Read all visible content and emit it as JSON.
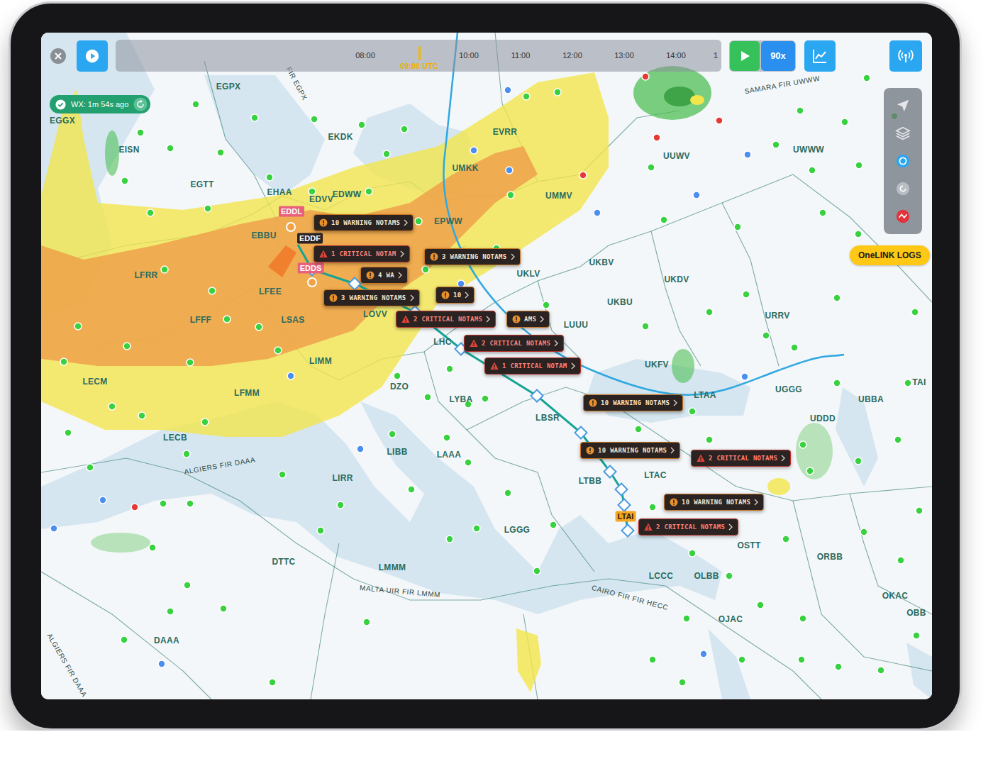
{
  "top_bar": {
    "timeline": {
      "ticks": [
        "08:00",
        "10:00",
        "11:00",
        "12:00",
        "13:00",
        "14:00",
        "1"
      ],
      "current": "09:00 UTC"
    },
    "speed": "90x"
  },
  "weather_status": {
    "text": "WX: 1m 54s ago"
  },
  "map_tools": [
    {
      "kind": "navigate",
      "selected": false
    },
    {
      "kind": "layers",
      "selected": false
    },
    {
      "kind": "radar",
      "selected": true
    },
    {
      "kind": "refresh",
      "selected": false
    },
    {
      "kind": "alerts",
      "selected": false
    }
  ],
  "logs_button": {
    "label": "OneLINK LOGS"
  },
  "airports": [
    {
      "code": "EDDL",
      "color": "#e8607c"
    },
    {
      "code": "EDDF",
      "color": "#2a2222"
    },
    {
      "code": "EDDS",
      "color": "#e8607c"
    },
    {
      "code": "LTAI",
      "color": "#f5a623"
    }
  ],
  "notams": [
    {
      "text": "10 WARNING NOTAMS",
      "kind": "warning"
    },
    {
      "text": "1 CRITICAL NOTAM",
      "kind": "critical"
    },
    {
      "text": "3 WARNING NOTAMS",
      "kind": "warning"
    },
    {
      "text": "4 WA",
      "kind": "warning"
    },
    {
      "text": "3 WARNING NOTAMS",
      "kind": "warning"
    },
    {
      "text": "10",
      "kind": "warning"
    },
    {
      "text": "2 CRITICAL NOTAMS",
      "kind": "critical"
    },
    {
      "text": "AMS",
      "kind": "warning"
    },
    {
      "text": "2 CRITICAL NOTAMS",
      "kind": "critical"
    },
    {
      "text": "1 CRITICAL NOTAM",
      "kind": "critical"
    },
    {
      "text": "10 WARNING NOTAMS",
      "kind": "warning"
    },
    {
      "text": "10 WARNING NOTAMS",
      "kind": "warning"
    },
    {
      "text": "2 CRITICAL NOTAMS",
      "kind": "critical"
    },
    {
      "text": "10 WARNING NOTAMS",
      "kind": "warning"
    },
    {
      "text": "2 CRITICAL NOTAMS",
      "kind": "critical"
    }
  ],
  "region_labels": [
    {
      "text": "EGGX"
    },
    {
      "text": "EGPX"
    },
    {
      "text": "EISN"
    },
    {
      "text": "EGTT"
    },
    {
      "text": "EHAA"
    },
    {
      "text": "EDVV"
    },
    {
      "text": "EDWW"
    },
    {
      "text": "EKDK"
    },
    {
      "text": "EVRR"
    },
    {
      "text": "UMKK"
    },
    {
      "text": "UMMV"
    },
    {
      "text": "EPWW"
    },
    {
      "text": "EBBU"
    },
    {
      "text": "LFRR"
    },
    {
      "text": "LFFF"
    },
    {
      "text": "LFEE"
    },
    {
      "text": "LSAS"
    },
    {
      "text": "LOVV"
    },
    {
      "text": "LHC"
    },
    {
      "text": "LIMM"
    },
    {
      "text": "LECM"
    },
    {
      "text": "LFMM"
    },
    {
      "text": "DZO"
    },
    {
      "text": "LYBA"
    },
    {
      "text": "LBSR"
    },
    {
      "text": "LECB"
    },
    {
      "text": "LIBB"
    },
    {
      "text": "LAAA"
    },
    {
      "text": "LIRR"
    },
    {
      "text": "LGGG"
    },
    {
      "text": "LTBB"
    },
    {
      "text": "LTAC"
    },
    {
      "text": "LTAA"
    },
    {
      "text": "UKLV"
    },
    {
      "text": "UKBV"
    },
    {
      "text": "UKDV"
    },
    {
      "text": "UKBU"
    },
    {
      "text": "LUUU"
    },
    {
      "text": "URRV"
    },
    {
      "text": "UKFV"
    },
    {
      "text": "UGGG"
    },
    {
      "text": "UBBA"
    },
    {
      "text": "UDDD"
    },
    {
      "text": "ORBB"
    },
    {
      "text": "OSTT"
    },
    {
      "text": "OLBB"
    },
    {
      "text": "LCCC"
    },
    {
      "text": "OJAC"
    },
    {
      "text": "OKAC"
    },
    {
      "text": "OBB"
    },
    {
      "text": "TAI"
    },
    {
      "text": "DTTC"
    },
    {
      "text": "LMMM"
    },
    {
      "text": "DAAA"
    },
    {
      "text": "UUWV"
    },
    {
      "text": "UWWW"
    }
  ],
  "fir_labels": [
    {
      "text": "FIR EGPX"
    },
    {
      "text": "SAMARA FIR UWWW"
    },
    {
      "text": "ALGIERS FIR DAAA"
    },
    {
      "text": "MALTA UIR FIR LMMM"
    },
    {
      "text": "CAIRO FIR FIR HECC"
    },
    {
      "text": "ALGIERS FIR DAAA"
    }
  ],
  "stations": [
    {
      "color": "#38d13f"
    },
    {
      "color": "#38d13f"
    },
    {
      "color": "#38d13f"
    },
    {
      "color": "#38d13f"
    },
    {
      "color": "#38d13f"
    },
    {
      "color": "#38d13f"
    },
    {
      "color": "#38d13f"
    },
    {
      "color": "#38d13f"
    },
    {
      "color": "#38d13f"
    },
    {
      "color": "#4b8ef0"
    },
    {
      "color": "#4b8ef0"
    },
    {
      "color": "#38d13f"
    },
    {
      "color": "#38d13f"
    },
    {
      "color": "#38d13f"
    },
    {
      "color": "#4b8ef0"
    },
    {
      "color": "#38d13f"
    },
    {
      "color": "#38d13f"
    },
    {
      "color": "#38d13f"
    },
    {
      "color": "#38d13f"
    },
    {
      "color": "#38d13f"
    },
    {
      "color": "#38d13f"
    },
    {
      "color": "#38d13f"
    },
    {
      "color": "#e53935"
    },
    {
      "color": "#e53935"
    },
    {
      "color": "#e53935"
    },
    {
      "color": "#e53935"
    },
    {
      "color": "#4b8ef0"
    },
    {
      "color": "#38d13f"
    },
    {
      "color": "#4b8ef0"
    },
    {
      "color": "#38d13f"
    },
    {
      "color": "#4b8ef0"
    },
    {
      "color": "#38d13f"
    },
    {
      "color": "#38d13f"
    },
    {
      "color": "#38d13f"
    },
    {
      "color": "#38d13f"
    },
    {
      "color": "#38d13f"
    },
    {
      "color": "#38d13f"
    },
    {
      "color": "#38d13f"
    },
    {
      "color": "#4b8ef0"
    },
    {
      "color": "#38d13f"
    },
    {
      "color": "#38d13f"
    },
    {
      "color": "#38d13f"
    },
    {
      "color": "#38d13f"
    },
    {
      "color": "#38d13f"
    },
    {
      "color": "#38d13f"
    },
    {
      "color": "#38d13f"
    },
    {
      "color": "#38d13f"
    },
    {
      "color": "#38d13f"
    },
    {
      "color": "#38d13f"
    },
    {
      "color": "#38d13f"
    },
    {
      "color": "#38d13f"
    },
    {
      "color": "#38d13f"
    },
    {
      "color": "#4b8ef0"
    },
    {
      "color": "#38d13f"
    },
    {
      "color": "#38d13f"
    },
    {
      "color": "#38d13f"
    },
    {
      "color": "#38d13f"
    },
    {
      "color": "#38d13f"
    },
    {
      "color": "#38d13f"
    },
    {
      "color": "#38d13f"
    },
    {
      "color": "#38d13f"
    },
    {
      "color": "#38d13f"
    },
    {
      "color": "#38d13f"
    },
    {
      "color": "#38d13f"
    },
    {
      "color": "#38d13f"
    },
    {
      "color": "#4b8ef0"
    },
    {
      "color": "#e53935"
    },
    {
      "color": "#4b8ef0"
    },
    {
      "color": "#38d13f"
    },
    {
      "color": "#38d13f"
    },
    {
      "color": "#38d13f"
    },
    {
      "color": "#38d13f"
    },
    {
      "color": "#4b8ef0"
    },
    {
      "color": "#38d13f"
    },
    {
      "color": "#38d13f"
    },
    {
      "color": "#38d13f"
    },
    {
      "color": "#38d13f"
    },
    {
      "color": "#38d13f"
    },
    {
      "color": "#4b8ef0"
    },
    {
      "color": "#38d13f"
    },
    {
      "color": "#38d13f"
    },
    {
      "color": "#38d13f"
    },
    {
      "color": "#38d13f"
    },
    {
      "color": "#38d13f"
    },
    {
      "color": "#38d13f"
    },
    {
      "color": "#38d13f"
    },
    {
      "color": "#38d13f"
    },
    {
      "color": "#38d13f"
    },
    {
      "color": "#38d13f"
    },
    {
      "color": "#38d13f"
    },
    {
      "color": "#38d13f"
    },
    {
      "color": "#38d13f"
    },
    {
      "color": "#38d13f"
    },
    {
      "color": "#38d13f"
    },
    {
      "color": "#38d13f"
    },
    {
      "color": "#38d13f"
    },
    {
      "color": "#38d13f"
    },
    {
      "color": "#38d13f"
    },
    {
      "color": "#38d13f"
    },
    {
      "color": "#4b8ef0"
    },
    {
      "color": "#38d13f"
    },
    {
      "color": "#38d13f"
    },
    {
      "color": "#38d13f"
    },
    {
      "color": "#38d13f"
    },
    {
      "color": "#38d13f"
    },
    {
      "color": "#38d13f"
    },
    {
      "color": "#38d13f"
    },
    {
      "color": "#38d13f"
    },
    {
      "color": "#38d13f"
    },
    {
      "color": "#38d13f"
    },
    {
      "color": "#38d13f"
    },
    {
      "color": "#38d13f"
    },
    {
      "color": "#38d13f"
    },
    {
      "color": "#38d13f"
    },
    {
      "color": "#38d13f"
    },
    {
      "color": "#38d13f"
    },
    {
      "color": "#38d13f"
    },
    {
      "color": "#38d13f"
    },
    {
      "color": "#38d13f"
    },
    {
      "color": "#38d13f"
    },
    {
      "color": "#38d13f"
    },
    {
      "color": "#38d13f"
    },
    {
      "color": "#38d13f"
    },
    {
      "color": "#38d13f"
    },
    {
      "color": "#4b8ef0"
    },
    {
      "color": "#38d13f"
    },
    {
      "color": "#38d13f"
    },
    {
      "color": "#38d13f"
    },
    {
      "color": "#38d13f"
    }
  ]
}
